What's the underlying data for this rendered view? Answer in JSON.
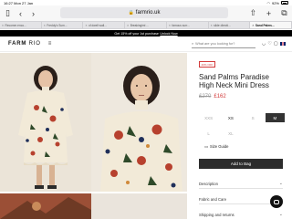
{
  "status_bar": {
    "time": "16:27",
    "date": "Mon 27 Jan",
    "battery": "92%"
  },
  "browser": {
    "url": "farmrio.uk",
    "tabs": [
      {
        "label": "Recomm enco..."
      },
      {
        "label": "Freddy's Sum..."
      },
      {
        "label": "of dwell wall..."
      },
      {
        "label": "Breakingimi ..."
      },
      {
        "label": "famous surr..."
      },
      {
        "label": "slide directi..."
      },
      {
        "label": "Sand Palms..."
      }
    ]
  },
  "promo": {
    "text": "Get 15% off your 1st purchase",
    "link": "Unlock Now"
  },
  "site": {
    "logo_primary": "FARM",
    "logo_secondary": "RIO",
    "search_placeholder": "What are you looking for?"
  },
  "product": {
    "badge": "40% OFF",
    "title": "Sand Palms Paradise High Neck Mini Dress",
    "old_price": "£270",
    "new_price": "£162",
    "sizes": [
      {
        "label": "XXS",
        "state": "oos"
      },
      {
        "label": "XS",
        "state": "available"
      },
      {
        "label": "S",
        "state": "oos"
      },
      {
        "label": "M",
        "state": "selected"
      },
      {
        "label": "L",
        "state": "oos"
      },
      {
        "label": "XL",
        "state": "oos"
      }
    ],
    "size_guide": "Size Guide",
    "add_to_bag": "Add to Bag",
    "accordions": [
      {
        "label": "Description"
      },
      {
        "label": "Fabric and Care"
      },
      {
        "label": "Shipping and returns"
      }
    ]
  },
  "colors": {
    "accent_red": "#d23a3a",
    "button_dark": "#2c2c2c"
  }
}
